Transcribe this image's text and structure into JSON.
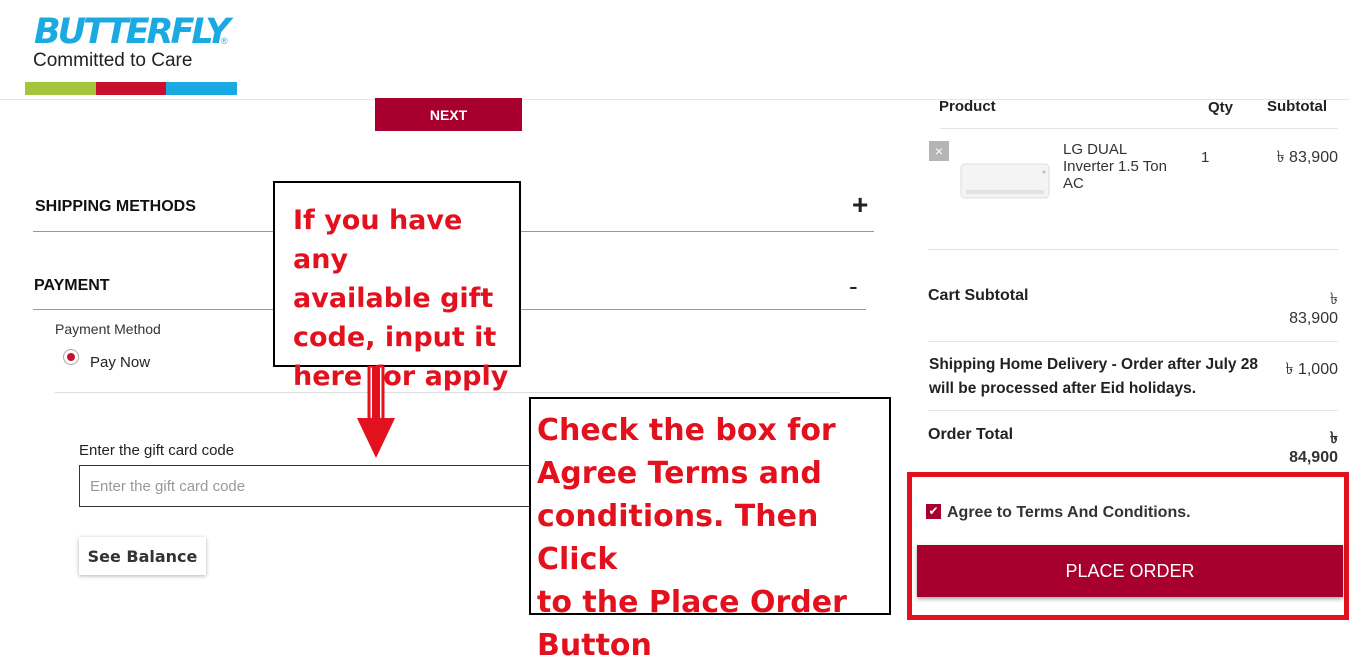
{
  "logo": {
    "wordmark": "BUTTERFLY",
    "registered": "®",
    "tagline": "Committed to Care",
    "stripe_colors": [
      "#a3c43b",
      "#c8102e",
      "#1ba9e1"
    ]
  },
  "checkout": {
    "next_label": "NEXT",
    "shipping_methods_title": "SHIPPING METHODS",
    "shipping_toggle": "+",
    "payment_title": "PAYMENT",
    "payment_toggle": "-",
    "payment_method_label": "Payment Method",
    "pay_now_label": "Pay Now",
    "gift_card_label": "Enter the gift card code",
    "gift_card_placeholder": "Enter the gift card code",
    "see_balance_label": "See Balance"
  },
  "annotations": {
    "gift_code_note": [
      "If you have any",
      "available gift",
      "code, input it",
      "here for apply"
    ],
    "place_order_note": [
      "Check the box for",
      "Agree Terms and",
      "conditions. Then Click",
      "to the Place Order",
      "Button"
    ]
  },
  "summary": {
    "headers": {
      "product": "Product",
      "qty": "Qty",
      "subtotal": "Subtotal"
    },
    "item": {
      "remove_icon": "×",
      "name_lines": [
        "LG DUAL",
        "Inverter 1.5 Ton",
        "AC"
      ],
      "qty": "1",
      "subtotal": "৳ 83,900"
    },
    "cart_subtotal_label": "Cart Subtotal",
    "cart_subtotal_currency": "৳",
    "cart_subtotal_value": "83,900",
    "shipping_label_line1": "Shipping Home Delivery - Order after July 28",
    "shipping_label_line2": "will be processed after Eid holidays.",
    "shipping_value": "৳ 1,000",
    "order_total_label": "Order Total",
    "order_total_currency": "৳",
    "order_total_value": "84,900",
    "agree_label": "Agree to Terms And Conditions.",
    "agree_checked": true,
    "place_order_label": "PLACE ORDER"
  },
  "colors": {
    "brand_red": "#a8002e",
    "annotation_red": "#e3111d",
    "logo_blue": "#1ba9e1"
  }
}
